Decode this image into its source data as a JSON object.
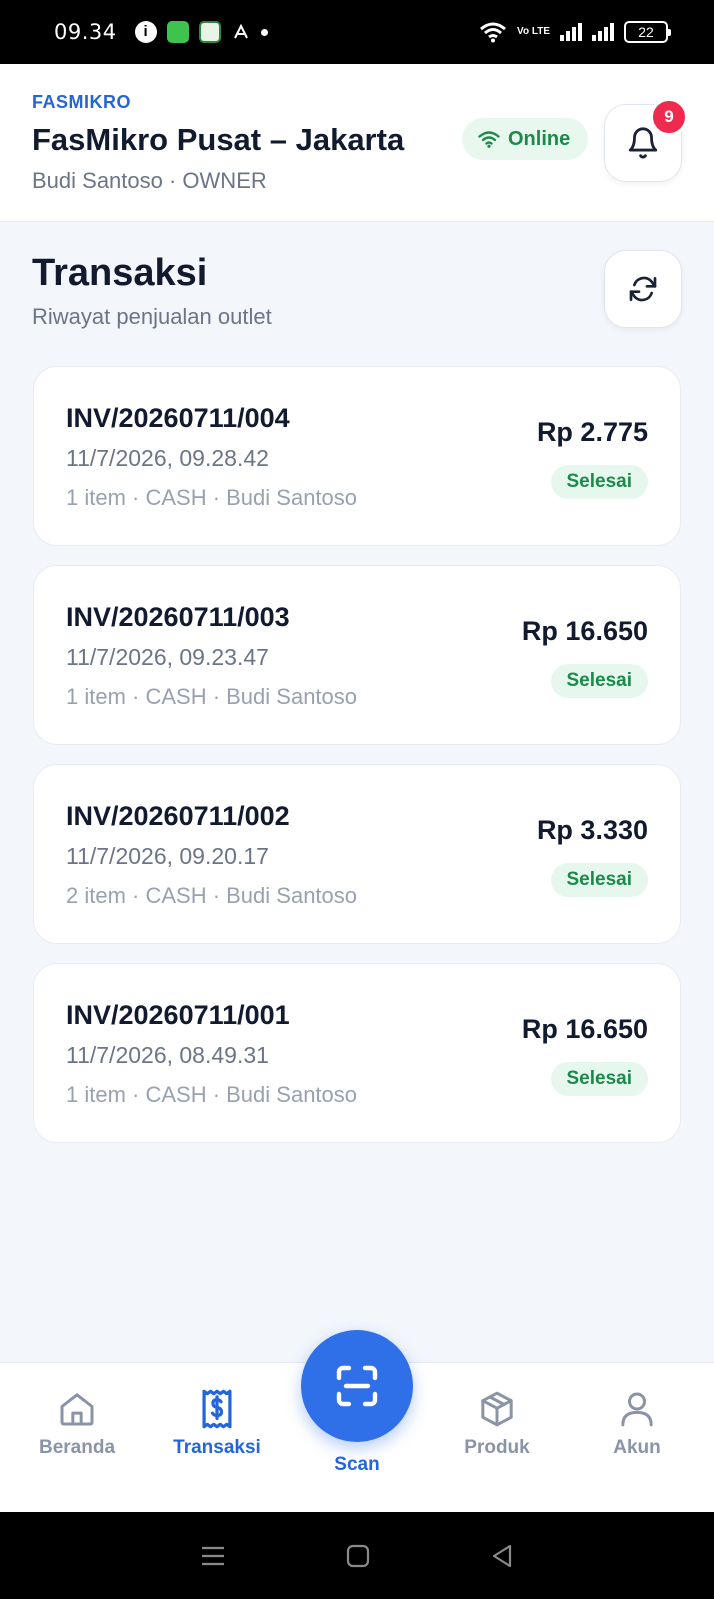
{
  "status_bar": {
    "time": "09.34",
    "network": "Vo LTE",
    "battery": "22"
  },
  "header": {
    "brand": "FASMIKRO",
    "outlet_name": "FasMikro Pusat – Jakarta",
    "user_line": "Budi Santoso · OWNER",
    "connection_status": "Online",
    "notification_count": "9"
  },
  "page": {
    "title": "Transaksi",
    "subtitle": "Riwayat penjualan outlet"
  },
  "transactions": [
    {
      "invoice": "INV/20260711/004",
      "datetime": "11/7/2026, 09.28.42",
      "meta": "1 item · CASH · Budi Santoso",
      "amount": "Rp 2.775",
      "status": "Selesai"
    },
    {
      "invoice": "INV/20260711/003",
      "datetime": "11/7/2026, 09.23.47",
      "meta": "1 item · CASH · Budi Santoso",
      "amount": "Rp 16.650",
      "status": "Selesai"
    },
    {
      "invoice": "INV/20260711/002",
      "datetime": "11/7/2026, 09.20.17",
      "meta": "2 item · CASH · Budi Santoso",
      "amount": "Rp 3.330",
      "status": "Selesai"
    },
    {
      "invoice": "INV/20260711/001",
      "datetime": "11/7/2026, 08.49.31",
      "meta": "1 item · CASH · Budi Santoso",
      "amount": "Rp 16.650",
      "status": "Selesai"
    }
  ],
  "bottom_nav": {
    "items": [
      {
        "label": "Beranda",
        "icon": "home-icon"
      },
      {
        "label": "Transaksi",
        "icon": "receipt-icon",
        "active": true
      },
      {
        "label": "Scan",
        "icon": "scan-icon"
      },
      {
        "label": "Produk",
        "icon": "box-icon"
      },
      {
        "label": "Akun",
        "icon": "user-icon"
      }
    ]
  },
  "colors": {
    "primary": "#2466d9",
    "scan_button": "#2f6fe8",
    "success": "#1c8a4b",
    "badge": "#ee2b4e",
    "background": "#f3f6fb"
  }
}
